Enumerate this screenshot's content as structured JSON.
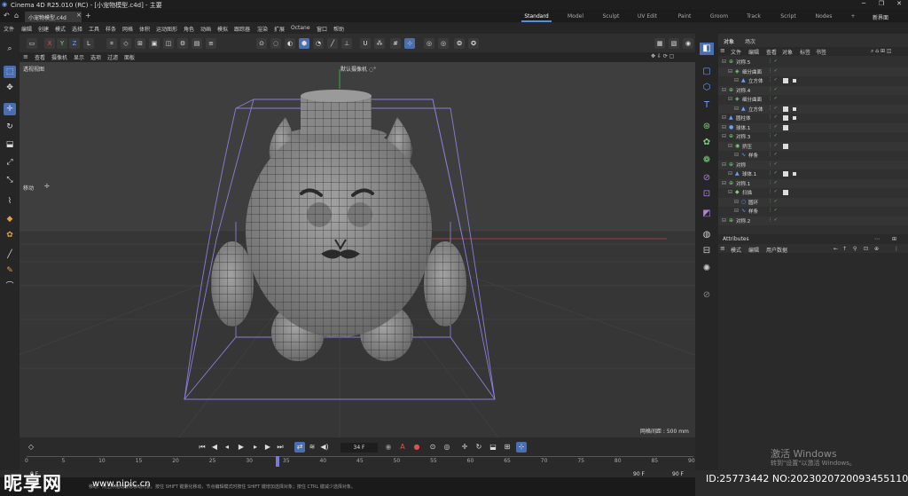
{
  "window": {
    "title": "Cinema 4D R25.010 (RC) - [小宠物模型.c4d] - 主要",
    "controls": [
      "─",
      "❐",
      "✕"
    ]
  },
  "doc_tab": {
    "label": "小宠物模型.c4d",
    "close": "×",
    "add": "+"
  },
  "layouts": [
    {
      "label": "Standard",
      "active": true
    },
    {
      "label": "Model"
    },
    {
      "label": "Sculpt"
    },
    {
      "label": "UV Edit"
    },
    {
      "label": "Paint"
    },
    {
      "label": "Groom"
    },
    {
      "label": "Track"
    },
    {
      "label": "Script"
    },
    {
      "label": "Nodes"
    },
    {
      "label": "+"
    },
    {
      "label": "新界面"
    }
  ],
  "menu": [
    "文件",
    "编辑",
    "创建",
    "模式",
    "选择",
    "工具",
    "样条",
    "网格",
    "体积",
    "运动图形",
    "角色",
    "动画",
    "模拟",
    "跟踪器",
    "渲染",
    "扩展",
    "Octane",
    "窗口",
    "帮助"
  ],
  "toolbar": {
    "axes": [
      "X",
      "Y",
      "Z"
    ],
    "coord": "L"
  },
  "viewport_menu": [
    "查看",
    "摄像机",
    "显示",
    "选项",
    "过滤",
    "面板"
  ],
  "viewport": {
    "label": "透视视图",
    "camera": "默认摄像机 ◌°",
    "mode_label": "移动",
    "grid_spacing": "网格间距 : 500 mm"
  },
  "timeline": {
    "current_frame": "34 F",
    "ticks": [
      "0",
      "5",
      "10",
      "15",
      "20",
      "25",
      "30",
      "35",
      "40",
      "45",
      "50",
      "55",
      "60",
      "65",
      "70",
      "75",
      "80",
      "85",
      "90"
    ],
    "end_frame": "90 F",
    "start_frame": "0 F",
    "playhead_frame": 34,
    "range_end": 90
  },
  "status": {
    "text": "移动：点击并拖动鼠标移动元素。按住 SHIFT 键量化移动，节点编辑模式时按住 SHIFT 键增加选择对象；按住 CTRL 键减少选择对象。"
  },
  "object_panel": {
    "tabs": [
      {
        "label": "对象",
        "active": true
      },
      {
        "label": "场次"
      }
    ],
    "menu": [
      "文件",
      "编辑",
      "查看",
      "对象",
      "标签",
      "书签"
    ],
    "objects": [
      {
        "name": "对称.5",
        "depth": 0,
        "icon": "symmetry-icon",
        "glyph": "⊕",
        "tags": 0
      },
      {
        "name": "细分曲面",
        "depth": 1,
        "icon": "subdivision-icon",
        "glyph": "◈",
        "tags": 0
      },
      {
        "name": "立方体",
        "depth": 2,
        "icon": "cube-icon",
        "glyph": "▲",
        "tags": 2
      },
      {
        "name": "对称.4",
        "depth": 0,
        "icon": "symmetry-icon",
        "glyph": "⊕",
        "tags": 0
      },
      {
        "name": "细分曲面",
        "depth": 1,
        "icon": "subdivision-icon",
        "glyph": "◈",
        "tags": 0
      },
      {
        "name": "立方体",
        "depth": 2,
        "icon": "cube-icon",
        "glyph": "▲",
        "tags": 2
      },
      {
        "name": "圆柱体",
        "depth": 0,
        "icon": "cylinder-icon",
        "glyph": "▲",
        "tags": 2
      },
      {
        "name": "球体.1",
        "depth": 0,
        "icon": "sphere-icon",
        "glyph": "●",
        "tags": 1
      },
      {
        "name": "对称.3",
        "depth": 0,
        "icon": "symmetry-icon",
        "glyph": "⊕",
        "tags": 0
      },
      {
        "name": "挤压",
        "depth": 1,
        "icon": "extrude-icon",
        "glyph": "◉",
        "tags": 1
      },
      {
        "name": "样条",
        "depth": 2,
        "icon": "spline-icon",
        "glyph": "∿",
        "tags": 0
      },
      {
        "name": "对称",
        "depth": 0,
        "icon": "symmetry-icon",
        "glyph": "⊕",
        "tags": 0
      },
      {
        "name": "球体.1",
        "depth": 1,
        "icon": "sphere-icon",
        "glyph": "▲",
        "tags": 2
      },
      {
        "name": "对称.1",
        "depth": 0,
        "icon": "symmetry-icon",
        "glyph": "⊕",
        "tags": 0
      },
      {
        "name": "扫描",
        "depth": 1,
        "icon": "sweep-icon",
        "glyph": "◆",
        "tags": 1
      },
      {
        "name": "圆环",
        "depth": 2,
        "icon": "circle-icon",
        "glyph": "○",
        "tags": 0
      },
      {
        "name": "样条",
        "depth": 2,
        "icon": "spline-icon",
        "glyph": "∿",
        "tags": 0
      },
      {
        "name": "对称.2",
        "depth": 0,
        "icon": "symmetry-icon",
        "glyph": "⊕",
        "tags": 0
      }
    ]
  },
  "attributes_panel": {
    "title": "Attributes",
    "menu": [
      "模式",
      "编辑",
      "用户数据"
    ],
    "nav": [
      "←",
      "↑",
      "⚲",
      "⊡",
      "⊕",
      "⋮"
    ]
  },
  "watermark": {
    "line1": "激活 Windows",
    "line2": "转到\"设置\"以激活 Windows。"
  },
  "overlay": {
    "site": "昵享网",
    "url": "www.nipic.cn",
    "image_id": "ID:25773442 NO:20230207200934551102"
  },
  "colors": {
    "accent": "#4a6fb0",
    "bounding_box": "#8a7ed8",
    "mesh_fill": "#8e8e8e",
    "wire": "#2a2a2a"
  }
}
